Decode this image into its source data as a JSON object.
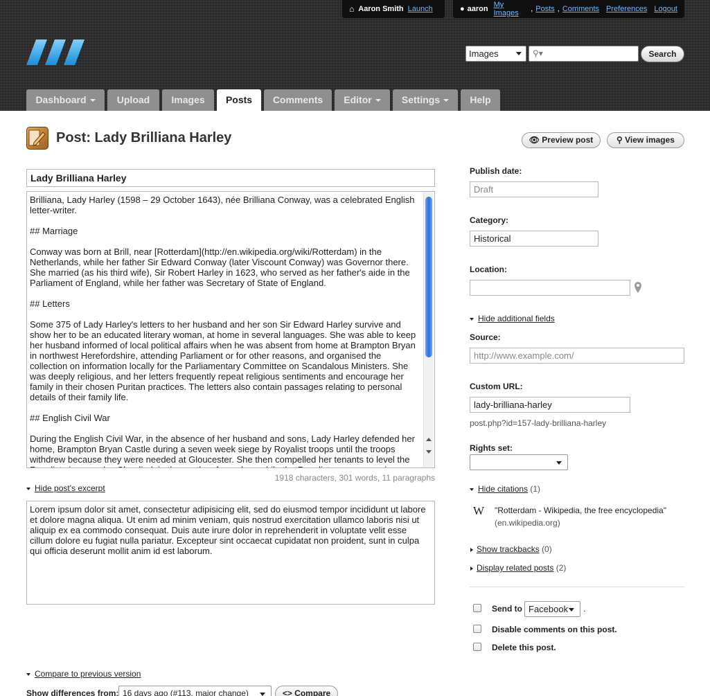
{
  "user_bar": {
    "user_name": "Aaron Smith",
    "launch": "Launch",
    "account": "aaron",
    "my_images": "My Images",
    "posts": "Posts",
    "comments": "Comments",
    "preferences": "Preferences",
    "logout": "Logout"
  },
  "search": {
    "scope": "Images",
    "button": "Search",
    "placeholder": ""
  },
  "tabs": [
    {
      "label": "Dashboard"
    },
    {
      "label": "Upload"
    },
    {
      "label": "Images"
    },
    {
      "label": "Posts"
    },
    {
      "label": "Comments"
    },
    {
      "label": "Editor"
    },
    {
      "label": "Settings"
    },
    {
      "label": "Help"
    }
  ],
  "page": {
    "title": "Post: Lady Brilliana Harley",
    "preview": "Preview post",
    "view_images": "View images"
  },
  "editor": {
    "title_value": "Lady Brilliana Harley",
    "body": [
      "Brilliana, Lady Harley (1598 – 29 October 1643), née Brilliana Conway, was a celebrated English letter-writer.",
      "## Marriage",
      "Conway was born at Brill, near [Rotterdam](http://en.wikipedia.org/wiki/Rotterdam) in the Netherlands, while her father Sir Edward Conway (later Viscount Conway) was Governor there. She married (as his third wife), Sir Robert Harley in 1623, who served as her father's aide in the Parliament of England, while her father was Secretary of State of England.",
      "## Letters",
      "Some 375 of Lady Harley's letters to her husband and her son Sir Edward Harley survive and show her to be an educated literary woman, at home in several languages. She was able to keep her husband informed of local political affairs when he was absent from home at Brampton Bryan in northwest Herefordshire, attending Parliament or for other reasons, and organised the collection on information locally for the Parliamentary Committee on Scandalous Ministers. She was deeply religious, and her letters frequently repeat religious sentiments and encourage her family in their chosen Puritan practices. The letters also contain passages relating to personal details of their family life.",
      "## English Civil War",
      "During the English Civil War, in the absence of her husband and sons, Lady Harley defended her home, Brampton Bryan Castle during a seven week siege by Royalist troops until the troops withdrew because they were needed at Gloucester. She then compelled her tenants to level the Royalist siege-works. She died, in the castle, of apoplexy while the Royalists were preparing a second siege."
    ],
    "counts": "1918 characters, 301 words, 11 paragraphs",
    "excerpt_toggle": "Hide post's excerpt",
    "excerpt": "Lorem ipsum dolor sit amet, consectetur adipisicing elit, sed do eiusmod tempor incididunt ut labore et dolore magna aliqua. Ut enim ad minim veniam, quis nostrud exercitation ullamco laboris nisi ut aliquip ex ea commodo consequat. Duis aute irure dolor in reprehenderit in voluptate velit esse cillum dolore eu fugiat nulla pariatur. Excepteur sint occaecat cupidatat non proident, sunt in culpa qui officia deserunt mollit anim id est laborum.",
    "compare_toggle": "Compare to previous version",
    "show_diff_label": "Show differences from:",
    "diff_select": "16 days ago (#113, major change)",
    "compare_button": "Compare"
  },
  "sidebar": {
    "publish_label": "Publish date:",
    "publish_placeholder": "Draft",
    "category_label": "Category:",
    "category_value": "Historical",
    "location_label": "Location:",
    "location_value": "",
    "additional_toggle": "Hide additional fields",
    "source_label": "Source:",
    "source_placeholder": "http://www.example.com/",
    "custom_url_label": "Custom URL:",
    "custom_url_value": "lady-brilliana-harley",
    "custom_url_hint": "post.php?id=157-lady-brilliana-harley",
    "rights_label": "Rights set:",
    "rights_value": "",
    "citations_toggle": "Hide citations",
    "citations_count": "(1)",
    "citation_glyph": "W",
    "citation_title": "\"Rotterdam - Wikipedia, the free encyclopedia\"",
    "citation_domain": "(en.wikipedia.org)",
    "trackbacks_toggle": "Show trackbacks",
    "trackbacks_count": "(0)",
    "related_toggle": "Display related posts",
    "related_count": "(2)",
    "send_to_label": "Send to",
    "send_to_value": "Facebook",
    "send_to_dot": ".",
    "disable_comments_label": "Disable comments on this post.",
    "delete_label": "Delete this post."
  },
  "colors": {
    "header_bg": "#2b2b2b",
    "tab_bg": "#8f8f8f",
    "link_blue": "#6fb8ff",
    "logo_blue": "#29a3e8"
  }
}
